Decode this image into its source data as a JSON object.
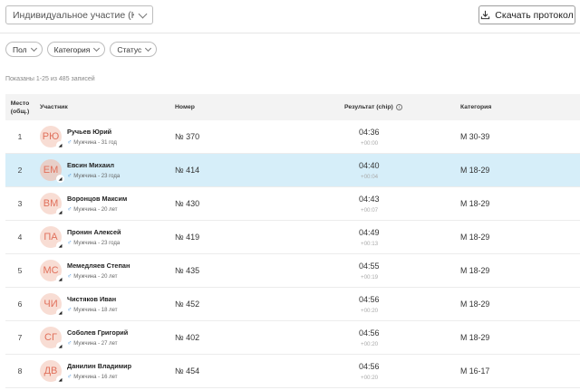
{
  "header": {
    "select_value": "Индивидуальное участие (Ква...",
    "download_label": "Скачать протокол"
  },
  "filters": [
    {
      "label": "Пол"
    },
    {
      "label": "Категория"
    },
    {
      "label": "Статус"
    }
  ],
  "records_info": "Показаны 1-25 из 485 записей",
  "table": {
    "columns": {
      "place_line1": "Место",
      "place_line2": "(общ.)",
      "participant": "Участник",
      "number": "Номер",
      "result": "Результат (chip)",
      "category": "Категория"
    },
    "rows": [
      {
        "place": "1",
        "initials": "РЮ",
        "name": "Ручьев Юрий",
        "sub": "Мужчина - 31 год",
        "number": "№ 370",
        "time": "04:36",
        "gap": "+00:00",
        "category": "М 30-39",
        "highlight": false
      },
      {
        "place": "2",
        "initials": "ЕМ",
        "name": "Евсин Михаил",
        "sub": "Мужчина - 23 года",
        "number": "№ 414",
        "time": "04:40",
        "gap": "+00:04",
        "category": "М 18-29",
        "highlight": true
      },
      {
        "place": "3",
        "initials": "ВМ",
        "name": "Воронцов Максим",
        "sub": "Мужчина - 20 лет",
        "number": "№ 430",
        "time": "04:43",
        "gap": "+00:07",
        "category": "М 18-29",
        "highlight": false
      },
      {
        "place": "4",
        "initials": "ПА",
        "name": "Пронин Алексей",
        "sub": "Мужчина - 23 года",
        "number": "№ 419",
        "time": "04:49",
        "gap": "+00:13",
        "category": "М 18-29",
        "highlight": false
      },
      {
        "place": "5",
        "initials": "МС",
        "name": "Мемедляев Степан",
        "sub": "Мужчина - 20 лет",
        "number": "№ 435",
        "time": "04:55",
        "gap": "+00:19",
        "category": "М 18-29",
        "highlight": false
      },
      {
        "place": "6",
        "initials": "ЧИ",
        "name": "Чистяков Иван",
        "sub": "Мужчина - 18 лет",
        "number": "№ 452",
        "time": "04:56",
        "gap": "+00:20",
        "category": "М 18-29",
        "highlight": false
      },
      {
        "place": "7",
        "initials": "СГ",
        "name": "Соболев Григорий",
        "sub": "Мужчина - 27 лет",
        "number": "№ 402",
        "time": "04:56",
        "gap": "+00:20",
        "category": "М 18-29",
        "highlight": false
      },
      {
        "place": "8",
        "initials": "ДВ",
        "name": "Данилин Владимир",
        "sub": "Мужчина - 16 лет",
        "number": "№ 454",
        "time": "04:56",
        "gap": "+00:20",
        "category": "М 16-17",
        "highlight": false
      }
    ]
  },
  "icons": {
    "download": "download-icon",
    "chevron": "chevron-down-icon",
    "info": "info-icon",
    "male": "male-icon",
    "runner_badge": "running-shoe-icon"
  },
  "colors": {
    "highlight_row": "#d6eef9",
    "avatar_bg": "#f8ddd4",
    "avatar_text": "#e0705b",
    "male_icon": "#3b8bd8"
  }
}
